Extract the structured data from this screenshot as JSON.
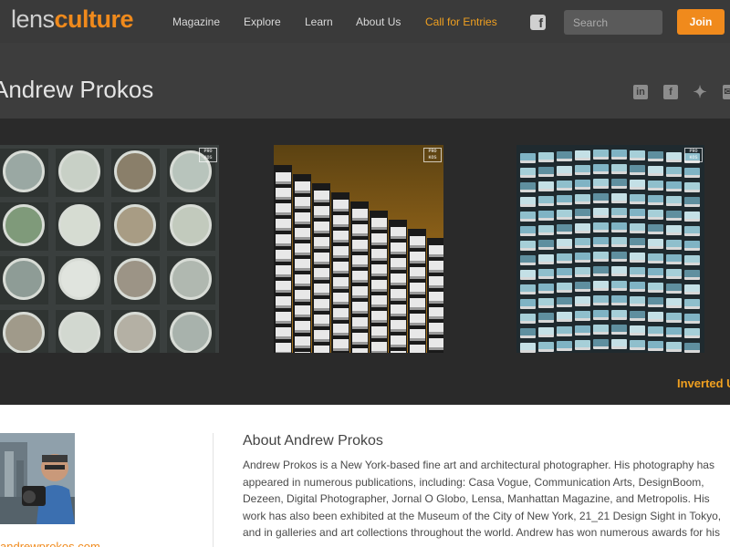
{
  "nav": {
    "logo_part1": "lens",
    "logo_part2": "culture",
    "links": [
      "Magazine",
      "Explore",
      "Learn",
      "About Us",
      "Call for Entries"
    ],
    "facebook_glyph": "f",
    "search_placeholder": "Search",
    "join_label": "Join",
    "accent_color": "#f08a1c"
  },
  "header": {
    "photographer_name": "Andrew Prokos",
    "share_icons": [
      "linkedin-icon",
      "facebook-icon",
      "twitter-icon",
      "email-icon"
    ]
  },
  "gallery": {
    "caption": "Inverted U...",
    "watermark": "PRO KOS"
  },
  "about": {
    "title": "About Andrew Prokos",
    "text": "Andrew Prokos is a New York-based fine art and architectural photographer. His photography has appeared in numerous publications, including: Casa Vogue, Communication Arts, DesignBoom, Dezeen, Digital Photographer, Jornal O Globo, Lensa, Manhattan Magazine, and Metropolis. His work has also been exhibited at the Museum of the City of New York, 21_21 Design Sight in Tokyo, and in galleries and art collections throughout the world. Andrew has won numerous awards for his",
    "website": "andrewprokos.com"
  }
}
